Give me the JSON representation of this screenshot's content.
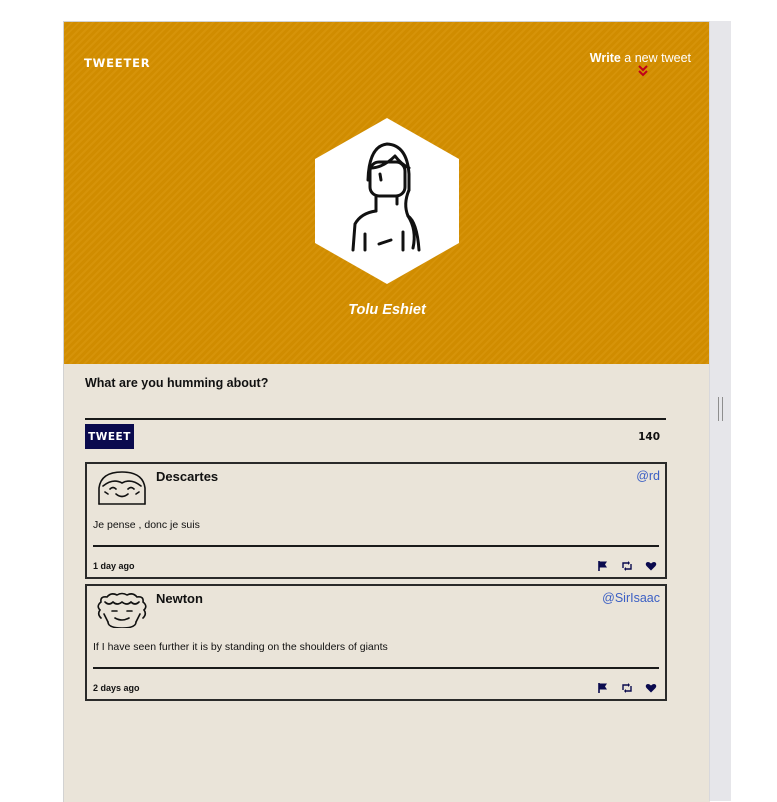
{
  "header": {
    "brand": "TWEETER",
    "compose_link_bold": "Write",
    "compose_link_rest": " a new tweet",
    "user_name": "Tolu Eshiet",
    "accent_color": "#d48f00"
  },
  "compose": {
    "prompt": "What are you humming about?",
    "input_value": "",
    "button_label": "TWEET",
    "char_count": "140",
    "button_color": "#0a0a4e"
  },
  "tweets": [
    {
      "name": "Descartes",
      "handle": "@rd",
      "text": "Je pense , donc je suis",
      "time": "1 day ago",
      "avatar_icon": "smiling-face-icon"
    },
    {
      "name": "Newton",
      "handle": "@SirIsaac",
      "text": "If I have seen further it is by standing on the shoulders of giants",
      "time": "2 days ago",
      "avatar_icon": "curly-hair-face-icon"
    }
  ],
  "actions": [
    "flag-icon",
    "retweet-icon",
    "heart-icon"
  ],
  "colors": {
    "page_background": "#eae4d9",
    "handle_link": "#3b5fc4",
    "chevron": "#c0001a"
  }
}
